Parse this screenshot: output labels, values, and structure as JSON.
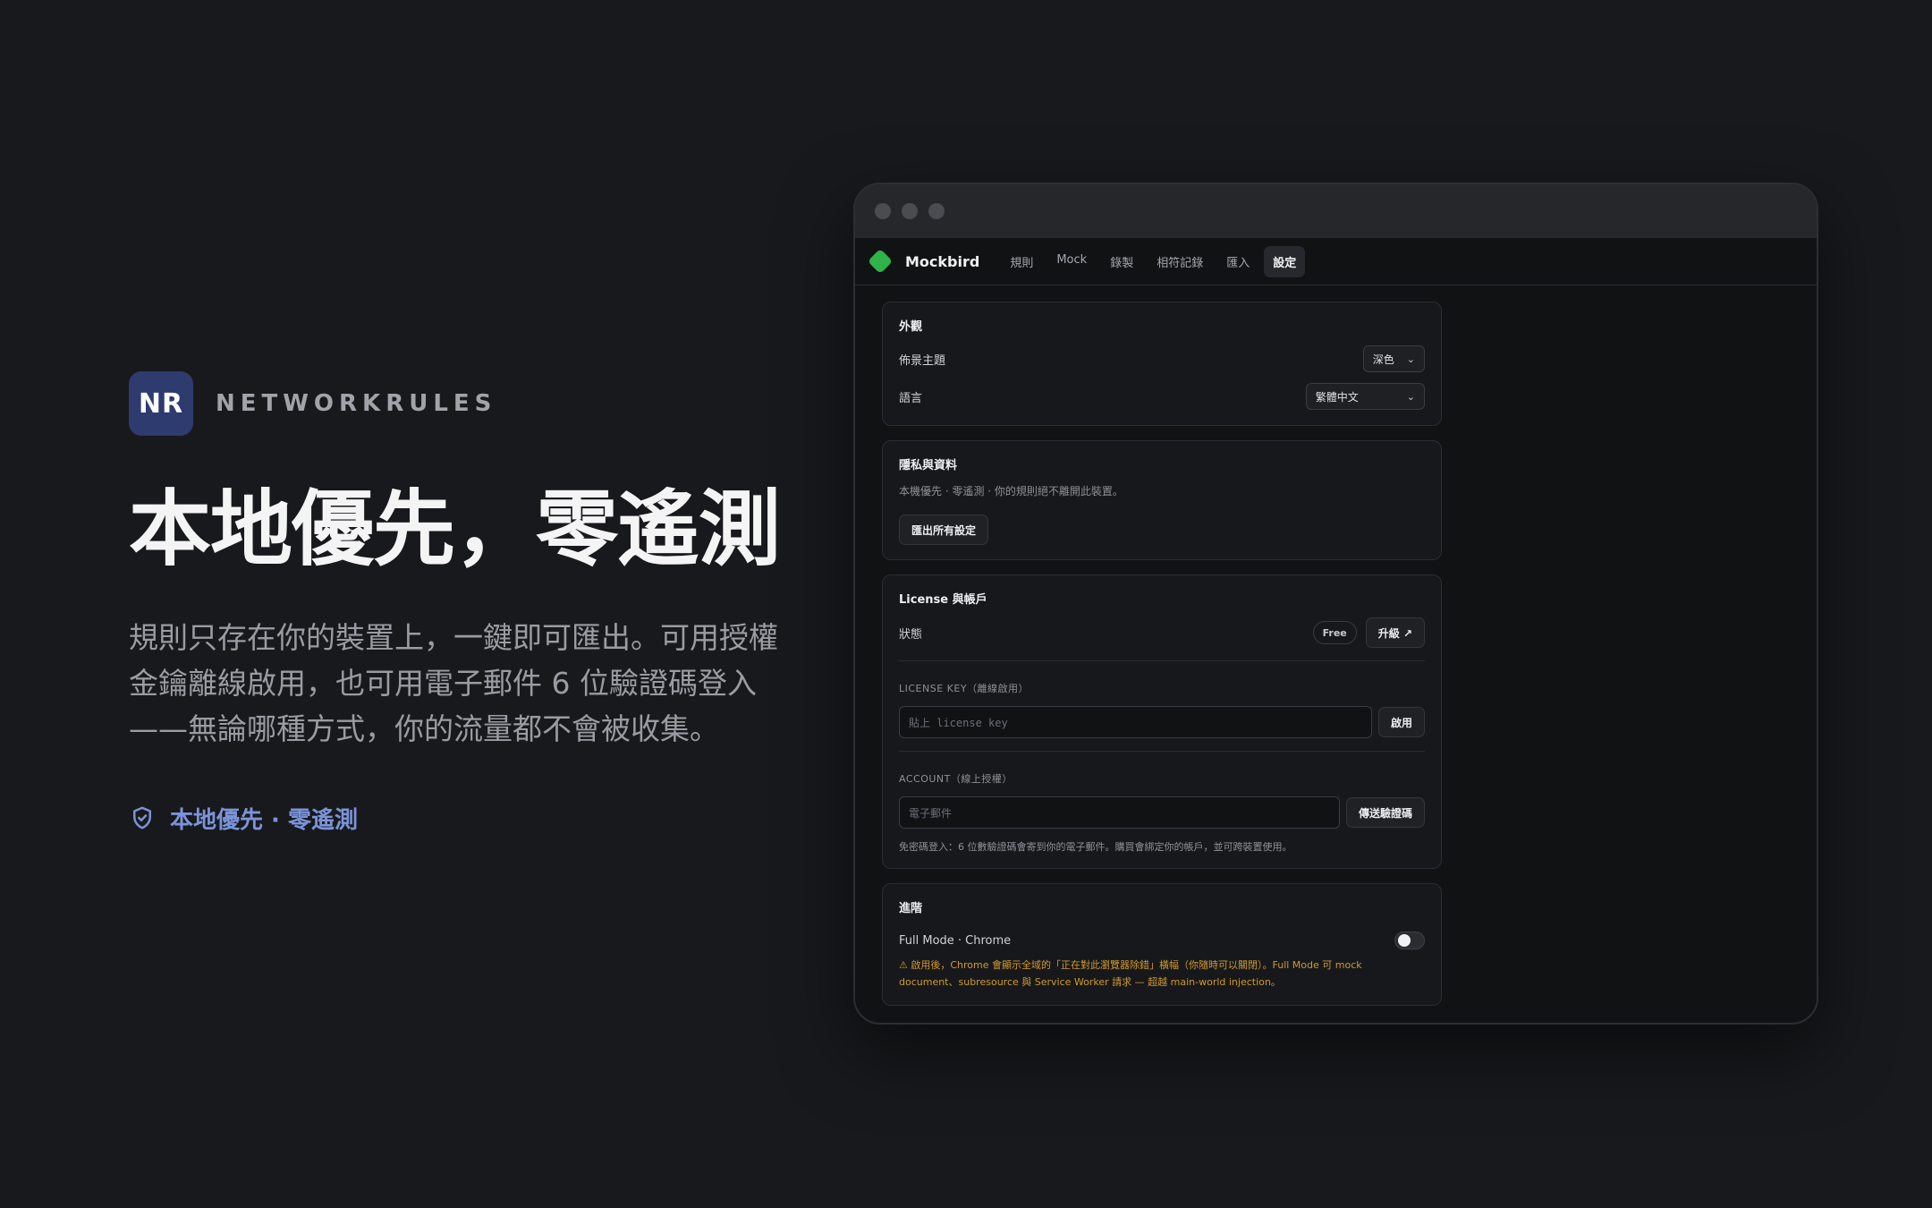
{
  "brand": {
    "badge": "NR",
    "name": "NETWORKRULES"
  },
  "hero": {
    "title": "本地優先，零遙測",
    "description_lines": [
      "規則只存在你的裝置上，一鍵即可匯出。可用授權",
      "金鑰離線啟用，也可用電子郵件 6 位驗證碼登入",
      "——無論哪種方式，你的流量都不會被收集。"
    ],
    "tag": "本地優先 · 零遙測",
    "tag_icon": "shield-check-icon",
    "accent": "#7b93d8"
  },
  "app": {
    "name": "Mockbird",
    "logo_color": "#2fb24a",
    "tabs": [
      {
        "label": "規則"
      },
      {
        "label": "Mock"
      },
      {
        "label": "錄製"
      },
      {
        "label": "相符記錄"
      },
      {
        "label": "匯入"
      },
      {
        "label": "設定",
        "active": true
      }
    ]
  },
  "appearance": {
    "title": "外觀",
    "theme_label": "佈景主題",
    "theme_value": "深色",
    "language_label": "語言",
    "language_value": "繁體中文"
  },
  "privacy": {
    "title": "隱私與資料",
    "description": "本機優先 · 零遙測 · 你的規則絕不離開此裝置。",
    "export_button": "匯出所有設定"
  },
  "license": {
    "title": "License 與帳戶",
    "status_label": "狀態",
    "status_value": "Free",
    "upgrade_button": "升級 ↗",
    "license_key_label": "LICENSE KEY（離線啟用）",
    "license_key_placeholder": "貼上 license key",
    "activate_button": "啟用",
    "account_label": "ACCOUNT（線上授權）",
    "email_placeholder": "電子郵件",
    "send_code_button": "傳送驗證碼",
    "hint": "免密碼登入：6 位數驗證碼會寄到你的電子郵件。購買會綁定你的帳戶，並可跨裝置使用。"
  },
  "advanced": {
    "title": "進階",
    "full_mode_label": "Full Mode · Chrome",
    "full_mode_enabled": false,
    "warning_line1": "⚠ 啟用後，Chrome 會顯示全域的「正在對此瀏覽器除錯」橫幅（你隨時可以關閉）。Full Mode 可 mock",
    "warning_line2": "document、subresource 與 Service Worker 請求 — 超越 main-world injection。",
    "warning_color": "#cf9a2f"
  }
}
